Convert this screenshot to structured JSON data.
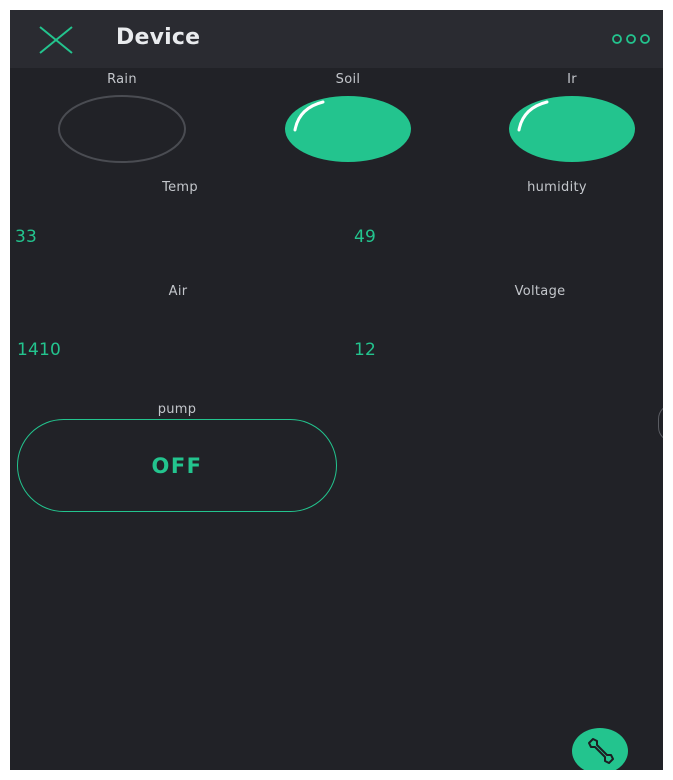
{
  "header": {
    "title": "Device",
    "close_icon": "close-icon",
    "menu_icon": "more-dots-icon"
  },
  "leds": [
    {
      "label": "Rain",
      "state": "off"
    },
    {
      "label": "Soil",
      "state": "on"
    },
    {
      "label": "Ir",
      "state": "on"
    }
  ],
  "displays": {
    "temp": {
      "label": "Temp",
      "value": "33"
    },
    "humidity": {
      "label": "humidity",
      "value": "49"
    },
    "air": {
      "label": "Air",
      "value": "1410"
    },
    "voltage": {
      "label": "Voltage",
      "value": "12"
    }
  },
  "pump": {
    "label": "pump",
    "state_text": "OFF"
  },
  "fab": {
    "icon": "wrench-icon"
  },
  "colors": {
    "accent": "#23c48e",
    "background": "#212227",
    "topbar": "#2a2b31",
    "label": "#c3c6cb",
    "led_off_border": "#4a4c52"
  }
}
